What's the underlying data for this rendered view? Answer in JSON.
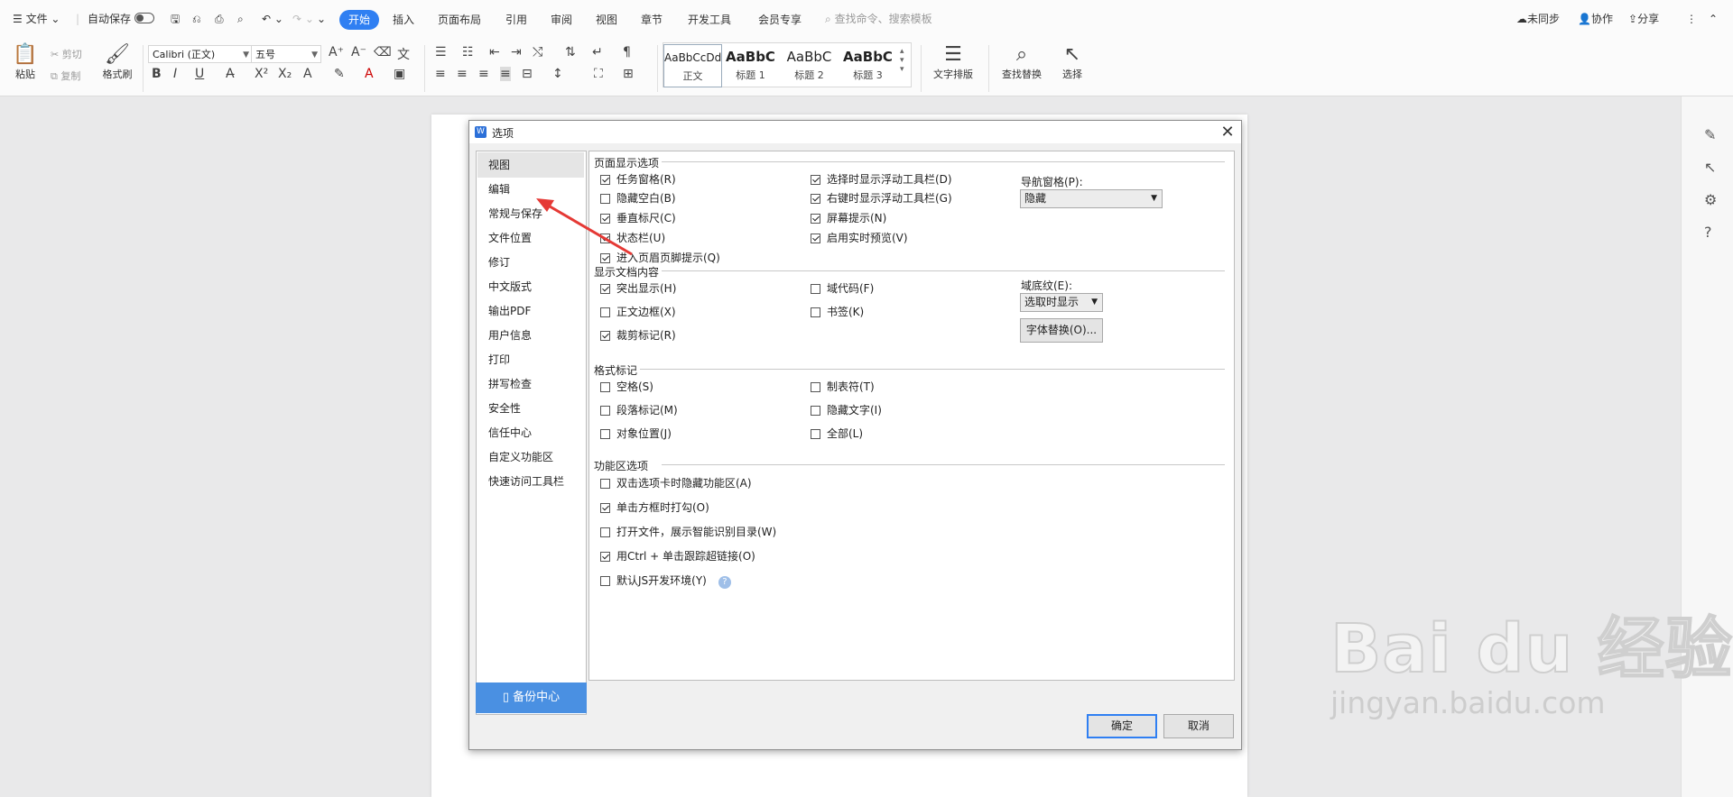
{
  "topbar": {
    "menu": "文件",
    "autosave": "自动保存",
    "tabs": [
      "开始",
      "插入",
      "页面布局",
      "引用",
      "审阅",
      "视图",
      "章节",
      "开发工具",
      "会员专享"
    ],
    "search_placeholder": "查找命令、搜索模板",
    "sync": "未同步",
    "collab": "协作",
    "share": "分享"
  },
  "ribbon": {
    "paste": "粘贴",
    "cut": "剪切",
    "copy": "复制",
    "format_painter": "格式刷",
    "font": "Calibri (正文)",
    "size": "五号",
    "styles": [
      {
        "preview": "AaBbCcDd",
        "label": "正文"
      },
      {
        "preview": "AaBbC",
        "label": "标题 1"
      },
      {
        "preview": "AaBbC",
        "label": "标题 2"
      },
      {
        "preview": "AaBbC",
        "label": "标题 3"
      }
    ],
    "text_layout": "文字排版",
    "find_replace": "查找替换",
    "select": "选择"
  },
  "dialog": {
    "title": "选项",
    "nav": [
      "视图",
      "编辑",
      "常规与保存",
      "文件位置",
      "修订",
      "中文版式",
      "输出PDF",
      "用户信息",
      "打印",
      "拼写检查",
      "安全性",
      "信任中心",
      "自定义功能区",
      "快速访问工具栏"
    ],
    "selected_nav": "视图",
    "backup": "备份中心",
    "sections": {
      "page_display": {
        "title": "页面显示选项",
        "options": [
          {
            "label": "任务窗格(R)",
            "checked": true
          },
          {
            "label": "隐藏空白(B)",
            "checked": false
          },
          {
            "label": "垂直标尺(C)",
            "checked": true
          },
          {
            "label": "状态栏(U)",
            "checked": true
          },
          {
            "label": "进入页眉页脚提示(Q)",
            "checked": true
          },
          {
            "label": "选择时显示浮动工具栏(D)",
            "checked": true
          },
          {
            "label": "右键时显示浮动工具栏(G)",
            "checked": true
          },
          {
            "label": "屏幕提示(N)",
            "checked": true
          },
          {
            "label": "启用实时预览(V)",
            "checked": true
          }
        ],
        "nav_pane_label": "导航窗格(P):",
        "nav_pane_value": "隐藏"
      },
      "doc_content": {
        "title": "显示文档内容",
        "options": [
          {
            "label": "突出显示(H)",
            "checked": true
          },
          {
            "label": "正文边框(X)",
            "checked": false
          },
          {
            "label": "裁剪标记(R)",
            "checked": true
          },
          {
            "label": "域代码(F)",
            "checked": false
          },
          {
            "label": "书签(K)",
            "checked": false
          }
        ],
        "shading_label": "域底纹(E):",
        "shading_value": "选取时显示",
        "font_sub_button": "字体替换(O)..."
      },
      "format_marks": {
        "title": "格式标记",
        "options": [
          {
            "label": "空格(S)",
            "checked": false
          },
          {
            "label": "段落标记(M)",
            "checked": false
          },
          {
            "label": "对象位置(J)",
            "checked": false
          },
          {
            "label": "制表符(T)",
            "checked": false
          },
          {
            "label": "隐藏文字(I)",
            "checked": false
          },
          {
            "label": "全部(L)",
            "checked": false
          }
        ]
      },
      "ribbon_opts": {
        "title": "功能区选项",
        "options": [
          {
            "label": "双击选项卡时隐藏功能区(A)",
            "checked": false
          },
          {
            "label": "单击方框时打勾(O)",
            "checked": true
          },
          {
            "label": "打开文件，展示智能识别目录(W)",
            "checked": false
          },
          {
            "label": "用Ctrl + 单击跟踪超链接(O)",
            "checked": true
          },
          {
            "label": "默认JS开发环境(Y)",
            "checked": false
          }
        ]
      }
    },
    "ok": "确定",
    "cancel": "取消"
  },
  "watermark": {
    "line1": "Bai du 经验",
    "line2": "jingyan.baidu.com"
  },
  "colors": {
    "accent": "#2f7ff2",
    "backup_bg": "#4a90e2",
    "annotation_arrow": "#e53935"
  }
}
